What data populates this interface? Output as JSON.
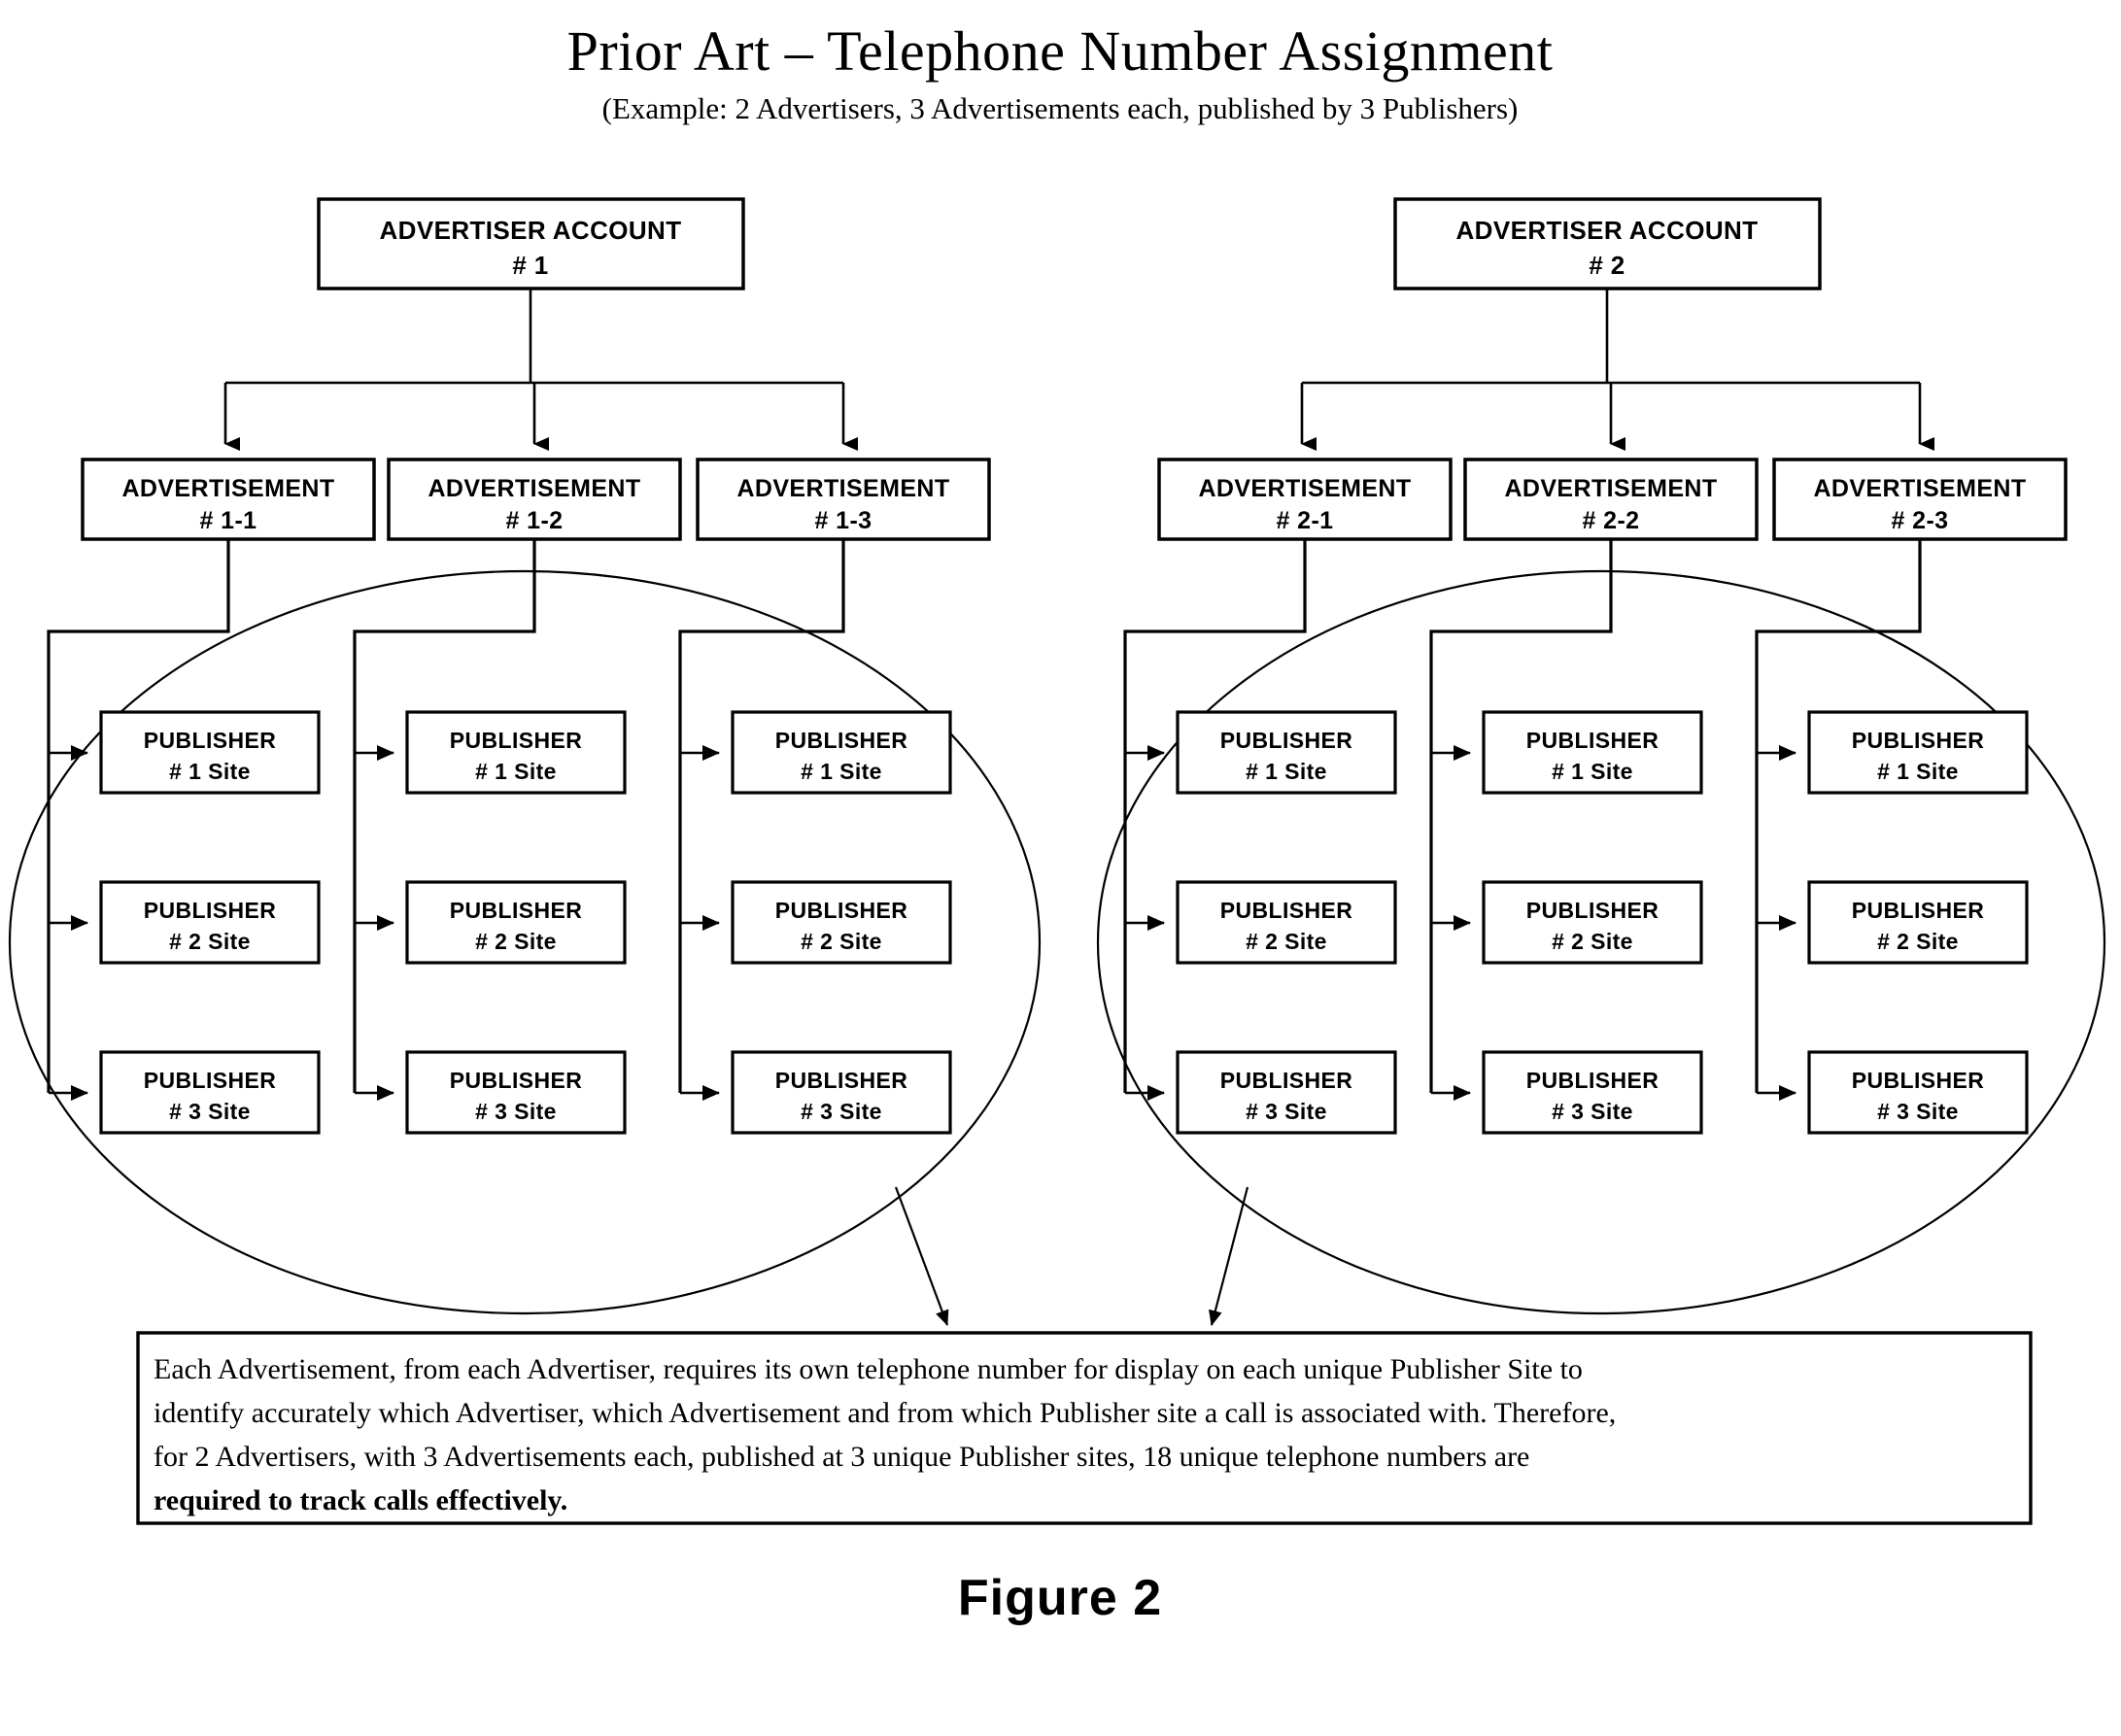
{
  "header": {
    "title": "Prior Art – Telephone Number Assignment",
    "subtitle": "(Example: 2 Advertisers, 3 Advertisements each, published by 3 Publishers)"
  },
  "figure": {
    "caption": "Figure 2"
  },
  "colors": {
    "stroke": "#000000",
    "fill": "#ffffff",
    "text": "#000000"
  },
  "diagram": {
    "groups": [
      {
        "id": "advertiser-1",
        "account": {
          "line1": "ADVERTISER ACCOUNT",
          "line2": "# 1"
        },
        "ads": [
          {
            "line1": "ADVERTISEMENT",
            "line2": "# 1-1",
            "publishers": [
              {
                "line1": "PUBLISHER",
                "line2": "# 1 Site"
              },
              {
                "line1": "PUBLISHER",
                "line2": "# 2 Site"
              },
              {
                "line1": "PUBLISHER",
                "line2": "# 3 Site"
              }
            ]
          },
          {
            "line1": "ADVERTISEMENT",
            "line2": "# 1-2",
            "publishers": [
              {
                "line1": "PUBLISHER",
                "line2": "# 1 Site"
              },
              {
                "line1": "PUBLISHER",
                "line2": "# 2 Site"
              },
              {
                "line1": "PUBLISHER",
                "line2": "# 3 Site"
              }
            ]
          },
          {
            "line1": "ADVERTISEMENT",
            "line2": "# 1-3",
            "publishers": [
              {
                "line1": "PUBLISHER",
                "line2": "# 1 Site"
              },
              {
                "line1": "PUBLISHER",
                "line2": "# 2 Site"
              },
              {
                "line1": "PUBLISHER",
                "line2": "# 3 Site"
              }
            ]
          }
        ]
      },
      {
        "id": "advertiser-2",
        "account": {
          "line1": "ADVERTISER ACCOUNT",
          "line2": "# 2"
        },
        "ads": [
          {
            "line1": "ADVERTISEMENT",
            "line2": "# 2-1",
            "publishers": [
              {
                "line1": "PUBLISHER",
                "line2": "# 1 Site"
              },
              {
                "line1": "PUBLISHER",
                "line2": "# 2 Site"
              },
              {
                "line1": "PUBLISHER",
                "line2": "# 3 Site"
              }
            ]
          },
          {
            "line1": "ADVERTISEMENT",
            "line2": "# 2-2",
            "publishers": [
              {
                "line1": "PUBLISHER",
                "line2": "# 1 Site"
              },
              {
                "line1": "PUBLISHER",
                "line2": "# 2 Site"
              },
              {
                "line1": "PUBLISHER",
                "line2": "# 3 Site"
              }
            ]
          },
          {
            "line1": "ADVERTISEMENT",
            "line2": "# 2-3",
            "publishers": [
              {
                "line1": "PUBLISHER",
                "line2": "# 1 Site"
              },
              {
                "line1": "PUBLISHER",
                "line2": "# 2 Site"
              },
              {
                "line1": "PUBLISHER",
                "line2": "# 3 Site"
              }
            ]
          }
        ]
      }
    ]
  },
  "callout": {
    "lines": [
      {
        "text": "Each Advertisement, from each Advertiser, requires its own telephone number for display on each unique Publisher Site to",
        "bold": false
      },
      {
        "text": "identify accurately which Advertiser, which Advertisement and from which Publisher site a call is associated with. Therefore,",
        "bold": false
      },
      {
        "text": "for 2 Advertisers, with 3 Advertisements each, published at 3 unique Publisher sites, ",
        "bold": false,
        "tail": "18 unique telephone numbers are",
        "tail_bold": true
      },
      {
        "text": "required to track calls effectively.",
        "bold": true
      }
    ]
  }
}
